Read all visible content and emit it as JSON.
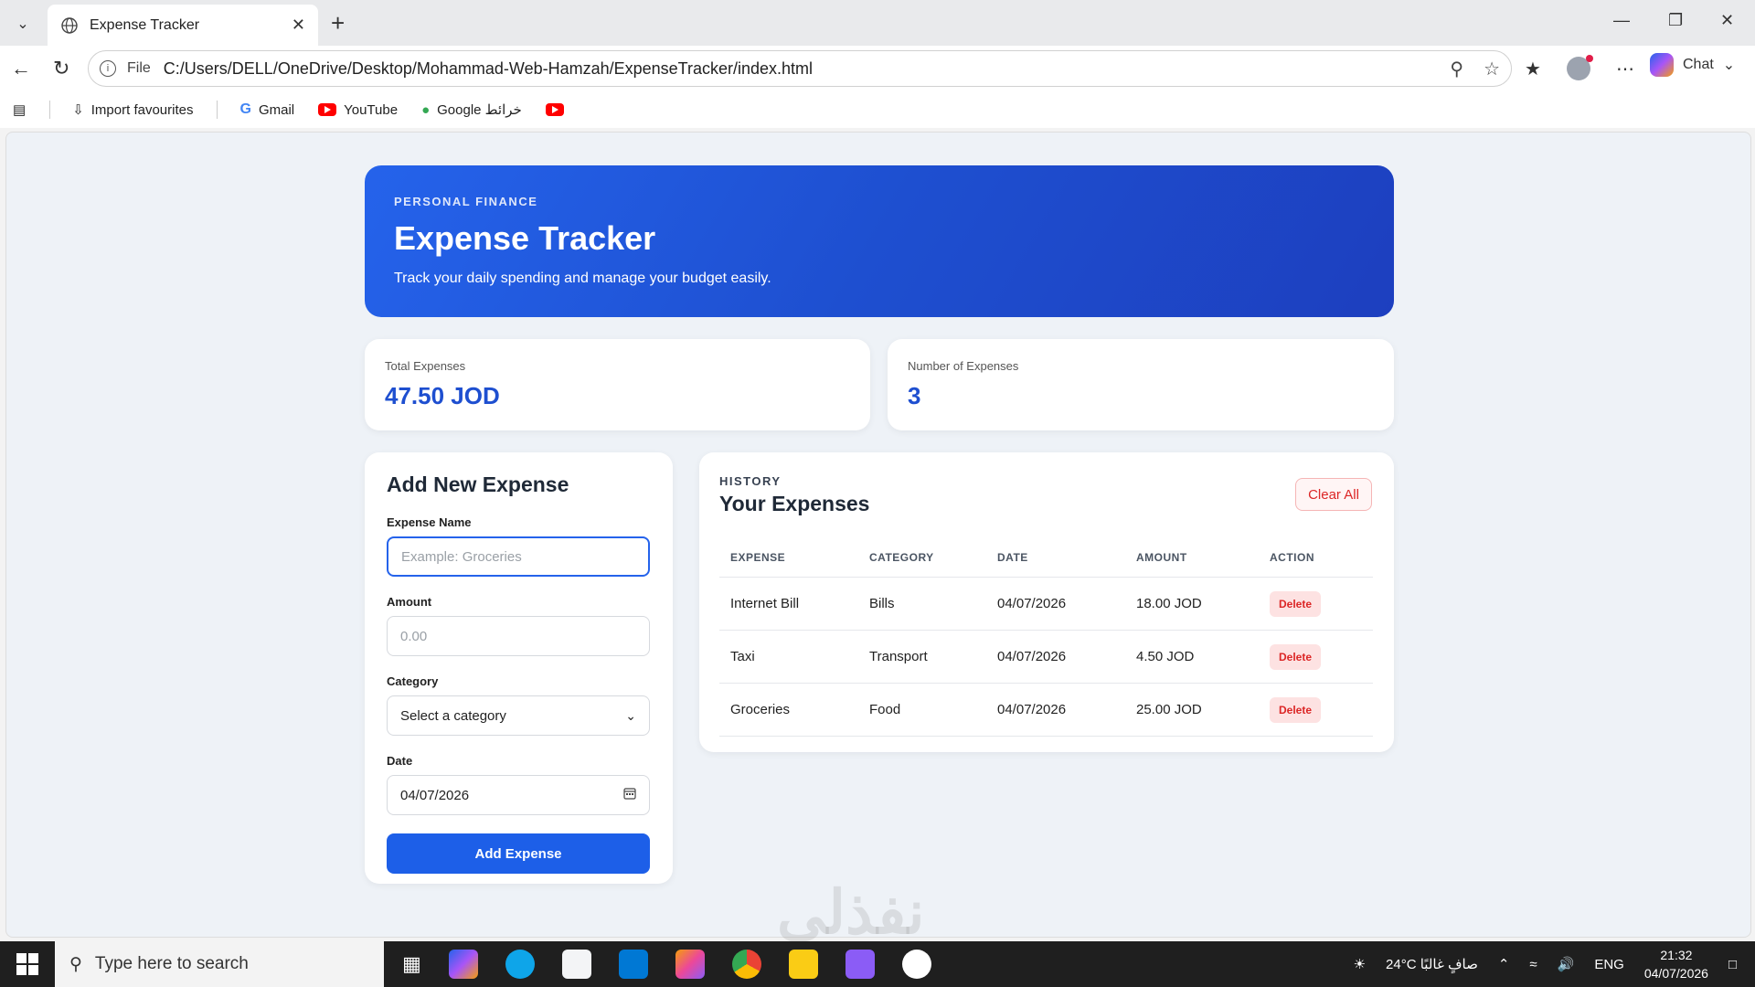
{
  "browser": {
    "tab_title": "Expense Tracker",
    "url_scheme": "File",
    "url": "C:/Users/DELL/OneDrive/Desktop/Mohammad-Web-Hamzah/ExpenseTracker/index.html",
    "chat_label": "Chat",
    "bookmarks": [
      {
        "label": "Import favourites",
        "icon": "import-icon"
      },
      {
        "label": "Gmail",
        "icon": "google-icon"
      },
      {
        "label": "YouTube",
        "icon": "youtube-icon"
      },
      {
        "label": "Google خرائط",
        "icon": "maps-icon"
      }
    ]
  },
  "hero": {
    "eyebrow": "PERSONAL FINANCE",
    "title": "Expense Tracker",
    "subtitle": "Track your daily spending and manage your budget easily."
  },
  "stats": {
    "total_label": "Total Expenses",
    "total_value": "47.50 JOD",
    "count_label": "Number of Expenses",
    "count_value": "3"
  },
  "form": {
    "title": "Add New Expense",
    "name_label": "Expense Name",
    "name_placeholder": "Example: Groceries",
    "amount_label": "Amount",
    "amount_placeholder": "0.00",
    "category_label": "Category",
    "category_value": "Select a category",
    "date_label": "Date",
    "date_value": "04/07/2026",
    "submit_label": "Add Expense"
  },
  "history": {
    "eyebrow": "HISTORY",
    "title": "Your Expenses",
    "clear_label": "Clear All",
    "columns": [
      "EXPENSE",
      "CATEGORY",
      "DATE",
      "AMOUNT",
      "ACTION"
    ],
    "rows": [
      {
        "expense": "Internet Bill",
        "category": "Bills",
        "date": "04/07/2026",
        "amount": "18.00 JOD",
        "action": "Delete"
      },
      {
        "expense": "Taxi",
        "category": "Transport",
        "date": "04/07/2026",
        "amount": "4.50 JOD",
        "action": "Delete"
      },
      {
        "expense": "Groceries",
        "category": "Food",
        "date": "04/07/2026",
        "amount": "25.00 JOD",
        "action": "Delete"
      }
    ]
  },
  "watermark": "نفذلي",
  "taskbar": {
    "search_placeholder": "Type here to search",
    "weather": "24°C صافٍ غالبًا",
    "language": "ENG",
    "time": "21:32",
    "date": "04/07/2026"
  },
  "colors": {
    "accent": "#1d5fe8",
    "danger": "#dc2626",
    "hero_start": "#2563eb",
    "hero_end": "#1d3fbf"
  }
}
